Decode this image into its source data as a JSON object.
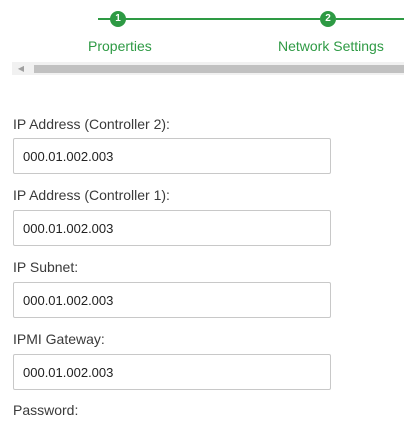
{
  "stepper": {
    "steps": [
      {
        "number": "1",
        "label": "Properties"
      },
      {
        "number": "2",
        "label": "Network Settings"
      }
    ],
    "accent_color": "#2e9a44"
  },
  "scrollbar": {
    "arrow_icon": "chevron-left-icon"
  },
  "form": {
    "fields": [
      {
        "label": "IP Address (Controller 2):",
        "value": "000.01.002.003"
      },
      {
        "label": "IP Address (Controller 1):",
        "value": "000.01.002.003"
      },
      {
        "label": "IP Subnet:",
        "value": "000.01.002.003"
      },
      {
        "label": "IPMI Gateway:",
        "value": "000.01.002.003"
      },
      {
        "label": "Password:"
      }
    ]
  }
}
